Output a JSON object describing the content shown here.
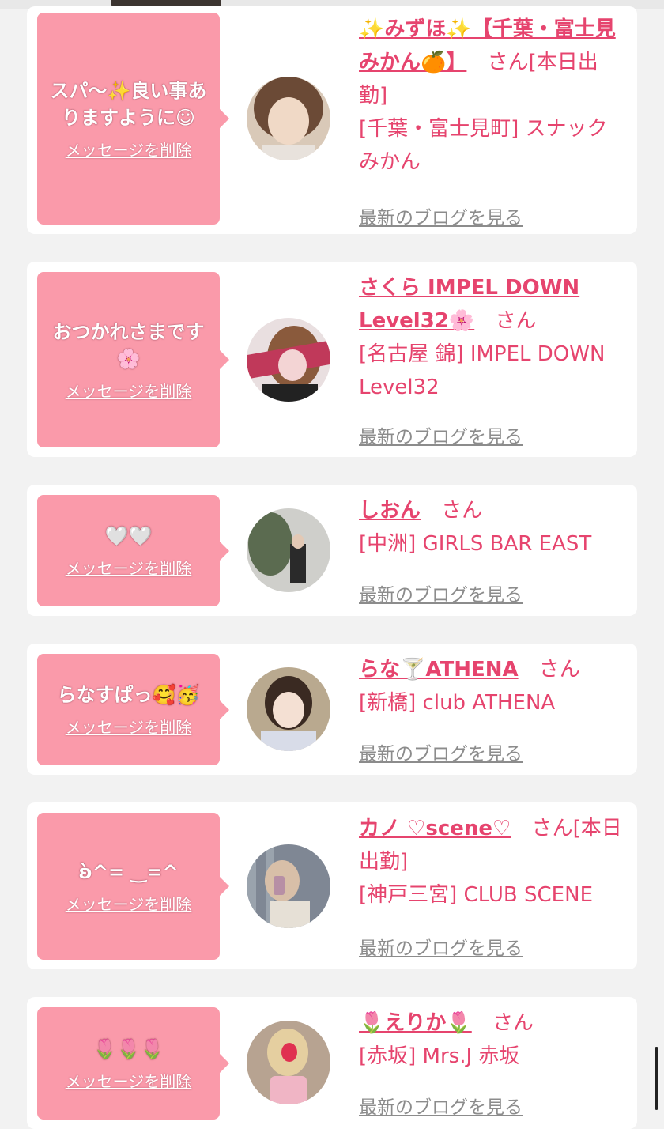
{
  "cards": [
    {
      "message": "スパ〜✨良い事ありますように☺",
      "delete_label": "メッセージを削除",
      "name": "✨みずほ✨【千葉・富士見みかん🍊】",
      "honorific": "さん",
      "status": "[本日出勤]",
      "shop": "[千葉・富士見町] スナックみかん",
      "blog_label": "最新のブログを見る",
      "avatar_color": "#6b4a36"
    },
    {
      "message": "おつかれさまです🌸",
      "delete_label": "メッセージを削除",
      "name": "さくら IMPEL DOWN Level32🌸",
      "honorific": "さん",
      "status": "",
      "shop": "[名古屋 錦] IMPEL DOWN Level32",
      "blog_label": "最新のブログを見る",
      "avatar_color": "#c0395a"
    },
    {
      "message": "🤍🤍",
      "delete_label": "メッセージを削除",
      "name": "しおん",
      "honorific": "さん",
      "status": "",
      "shop": "[中洲] GIRLS BAR EAST",
      "blog_label": "最新のブログを見る",
      "avatar_color": "#5b6b50"
    },
    {
      "message": "らなすぱっ🥰🥳",
      "delete_label": "メッセージを削除",
      "name": "らな🍸ATHENA",
      "honorific": "さん",
      "status": "",
      "shop": "[新橋] club ATHENA",
      "blog_label": "最新のブログを見る",
      "avatar_color": "#6e5a44"
    },
    {
      "message": "ʚ̀̀^= ‿=^",
      "delete_label": "メッセージを削除",
      "name": "カノ ♡scene♡",
      "honorific": "さん",
      "status": "[本日出勤]",
      "shop": "[神戸三宮] CLUB SCENE",
      "blog_label": "最新のブログを見る",
      "avatar_color": "#7f8794"
    },
    {
      "message": "🌷🌷🌷",
      "delete_label": "メッセージを削除",
      "name": "🌷えりか🌷",
      "honorific": "さん",
      "status": "",
      "shop": "[赤坂] Mrs.J 赤坂",
      "blog_label": "最新のブログを見る",
      "avatar_color": "#b7a391"
    }
  ]
}
